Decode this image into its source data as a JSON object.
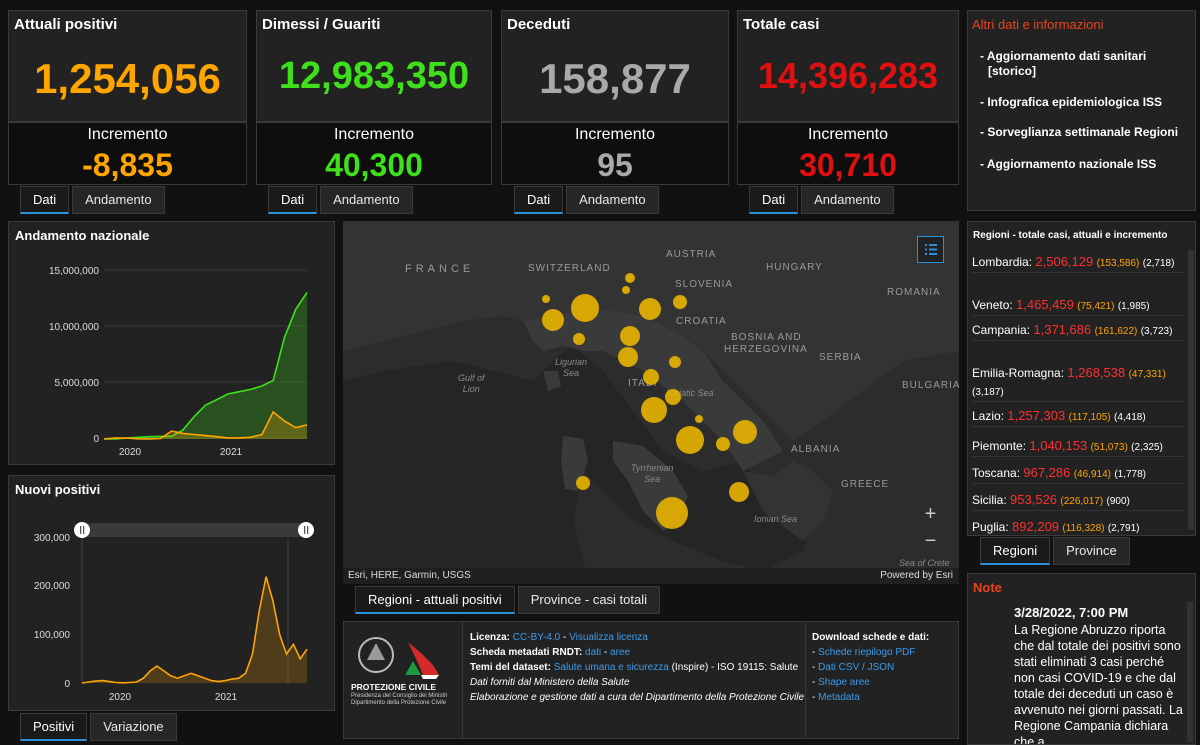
{
  "kpis": [
    {
      "title": "Attuali positivi",
      "value": "1,254,056",
      "inc_label": "Incremento",
      "inc_value": "-8,835",
      "color": "#ffa500"
    },
    {
      "title": "Dimessi / Guariti",
      "value": "12,983,350",
      "inc_label": "Incremento",
      "inc_value": "40,300",
      "color": "#3ee01b"
    },
    {
      "title": "Deceduti",
      "value": "158,877",
      "inc_label": "Incremento",
      "inc_value": "95",
      "color": "#a9a9a9"
    },
    {
      "title": "Totale casi",
      "value": "14,396,283",
      "inc_label": "Incremento",
      "inc_value": "30,710",
      "color": "#e01010"
    }
  ],
  "kpi_tabs": {
    "dati": "Dati",
    "andamento": "Andamento"
  },
  "info": {
    "title": "Altri dati e informazioni",
    "links": [
      "- Aggiornamento dati sanitari",
      "[storico]",
      "- Infografica epidemiologica ISS",
      "- Sorveglianza settimanale Regioni",
      "- Aggiornamento nazionale ISS"
    ]
  },
  "trend_chart": {
    "title": "Andamento nazionale",
    "y_ticks": [
      "15,000,000",
      "10,000,000",
      "5,000,000",
      "0"
    ],
    "x_ticks": [
      "2020",
      "2021"
    ]
  },
  "new_chart": {
    "title": "Nuovi positivi",
    "y_ticks": [
      "300,000",
      "200,000",
      "100,000",
      "0"
    ],
    "x_ticks": [
      "2020",
      "2021"
    ],
    "tabs": {
      "positivi": "Positivi",
      "variazione": "Variazione"
    }
  },
  "chart_data": [
    {
      "type": "area",
      "title": "Andamento nazionale",
      "ylim": [
        0,
        15000000
      ],
      "x_ticks": [
        "2020",
        "2021"
      ],
      "series": [
        {
          "values": [
            0,
            5000,
            80000,
            150000,
            200000,
            230000,
            250000,
            800000,
            2000000,
            3000000,
            3500000,
            4000000,
            4200000,
            4400000,
            4700000,
            5200000,
            9000000,
            11500000,
            13000000
          ],
          "color": "#3ee01b"
        },
        {
          "values": [
            0,
            100000,
            80000,
            20000,
            10000,
            40000,
            700000,
            500000,
            400000,
            300000,
            200000,
            100000,
            100000,
            150000,
            400000,
            2400000,
            1600000,
            1000000,
            1250000
          ],
          "color": "#ffa500"
        }
      ]
    },
    {
      "type": "line",
      "title": "Nuovi positivi",
      "ylim": [
        0,
        300000
      ],
      "x_ticks": [
        "2020",
        "2021"
      ],
      "series": [
        {
          "values": [
            0,
            2000,
            4000,
            5000,
            3000,
            1000,
            500,
            1000,
            2000,
            10000,
            25000,
            35000,
            25000,
            15000,
            10000,
            15000,
            20000,
            15000,
            10000,
            5000,
            3000,
            5000,
            8000,
            10000,
            20000,
            60000,
            150000,
            220000,
            170000,
            100000,
            60000,
            80000,
            50000,
            70000
          ],
          "color": "#ffa500"
        }
      ]
    }
  ],
  "map": {
    "countries": [
      "FRANCE",
      "SWITZERLAND",
      "AUSTRIA",
      "SLOVENIA",
      "HUNGARY",
      "ROMANIA",
      "CROATIA",
      "BOSNIA AND",
      "HERZEGOVINA",
      "SERBIA",
      "BULGARIA",
      "ITALY",
      "ALBANIA",
      "GREECE"
    ],
    "seas": {
      "ligurian": [
        "Ligurian",
        "Sea"
      ],
      "gulf": [
        "Gulf of",
        "Lion"
      ],
      "adriatic": "Adriatic Sea",
      "tyrrhenian": [
        "Tyrrhenian",
        "Sea"
      ],
      "ionian": "Ionian Sea",
      "crete": "Sea of Crete"
    },
    "attribution": "Esri, HERE, Garmin, USGS",
    "powered": "Powered by Esri",
    "zoom_in": "+",
    "zoom_out": "−",
    "bubble_color": "#e8b400",
    "tabs": {
      "regioni": "Regioni - attuali positivi",
      "province": "Province - casi totali"
    }
  },
  "regions": {
    "title": "Regioni - totale casi, attuali e incremento",
    "rows": [
      {
        "name": "Lombardia:",
        "tot": "2,506,129",
        "act": "(153,586)",
        "ded": "(2,718)"
      },
      {
        "name": "Veneto:",
        "tot": "1,465,459",
        "act": "(75,421)",
        "ded": "(1,985)"
      },
      {
        "name": "Campania:",
        "tot": "1,371,686",
        "act": "(161,622)",
        "ded": "(3,723)"
      },
      {
        "name": "Emilia-Romagna:",
        "tot": "1,268,538",
        "act": "(47,331)",
        "ded": "(3,187)"
      },
      {
        "name": "Lazio:",
        "tot": "1,257,303",
        "act": "(117,105)",
        "ded": "(4,418)"
      },
      {
        "name": "Piemonte:",
        "tot": "1,040,153",
        "act": "(51,073)",
        "ded": "(2,325)"
      },
      {
        "name": "Toscana:",
        "tot": "967,286",
        "act": "(46,914)",
        "ded": "(1,778)"
      },
      {
        "name": "Sicilia:",
        "tot": "953,526",
        "act": "(226,017)",
        "ded": "(900)"
      },
      {
        "name": "Puglia:",
        "tot": "892,209",
        "act": "(116,328)",
        "ded": "(2,791)"
      }
    ],
    "tabs": {
      "regioni": "Regioni",
      "province": "Province"
    }
  },
  "note": {
    "title": "Note",
    "date": "3/28/2022, 7:00 PM",
    "text": "La Regione Abruzzo riporta che dal totale dei positivi sono stati eliminati 3 casi perché non casi COVID-19 e che dal totale dei deceduti un caso è avvenuto nei giorni passati. La Regione Campania dichiara che a"
  },
  "footer": {
    "logo_caption": [
      "PROTEZIONE CIVILE",
      "Presidenza del Consiglio dei Ministri",
      "Dipartimento della Protezione Civile"
    ],
    "licenza_label": "Licenza:",
    "licenza_value": "CC-BY-4.0",
    "licenza_link": "Visualizza licenza",
    "metadati_label": "Scheda metadati RNDT:",
    "metadati_dati": "dati",
    "metadati_aree": "aree",
    "temi_label": "Temi del dataset:",
    "temi_value": "Salute umana e sicurezza",
    "temi_rest": "(Inspire) - ISO 19115: Salute",
    "line1": "Dati forniti dal Ministero della Salute",
    "line2": "Elaborazione e gestione dati a cura del Dipartimento della Protezione Civile",
    "download_title": "Download schede e dati:",
    "downloads": [
      "Schede riepilogo PDF",
      "Dati CSV / JSON",
      "Shape aree",
      "Metadata"
    ]
  }
}
